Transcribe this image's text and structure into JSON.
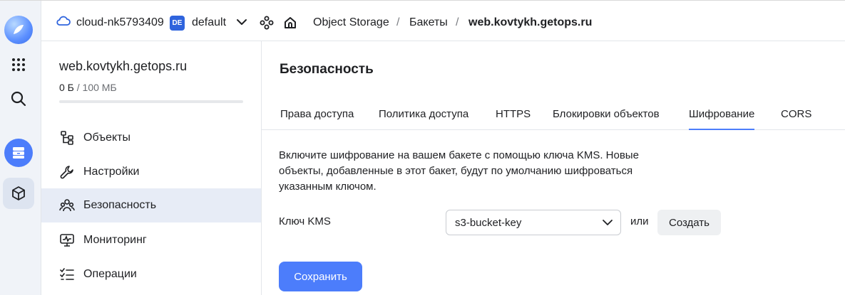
{
  "header": {
    "cloud_name": "cloud-nk5793409",
    "folder_badge": "DE",
    "folder_name": "default",
    "breadcrumbs": [
      "Object Storage",
      "Бакеты",
      "web.kovtykh.getops.ru"
    ],
    "separator": "/"
  },
  "sidebar": {
    "bucket_name": "web.kovtykh.getops.ru",
    "usage_used": "0 Б",
    "usage_total": "/ 100 МБ",
    "usage_fraction": 0.0,
    "items": [
      {
        "label": "Объекты",
        "icon": "objects-icon"
      },
      {
        "label": "Настройки",
        "icon": "wrench-icon"
      },
      {
        "label": "Безопасность",
        "icon": "users-icon",
        "active": true
      },
      {
        "label": "Мониторинг",
        "icon": "monitor-icon"
      },
      {
        "label": "Операции",
        "icon": "checklist-icon"
      }
    ]
  },
  "main": {
    "title": "Безопасность",
    "tabs": [
      "Права доступа",
      "Политика доступа",
      "HTTPS",
      "Блокировки объектов",
      "Шифрование",
      "CORS"
    ],
    "active_tab": "Шифрование",
    "description": "Включите шифрование на вашем бакете с помощью ключа KMS. Новые объекты, добавленные в этот бакет, будут по умолчанию шифроваться указанным ключом.",
    "kms_label": "Ключ KMS",
    "kms_value": "s3-bucket-key",
    "or_text": "или",
    "create_label": "Создать",
    "save_label": "Сохранить"
  },
  "colors": {
    "accent": "#4c7dfb",
    "rail_bg": "#f0f3f8",
    "active_nav_bg": "#e7ecf6"
  }
}
